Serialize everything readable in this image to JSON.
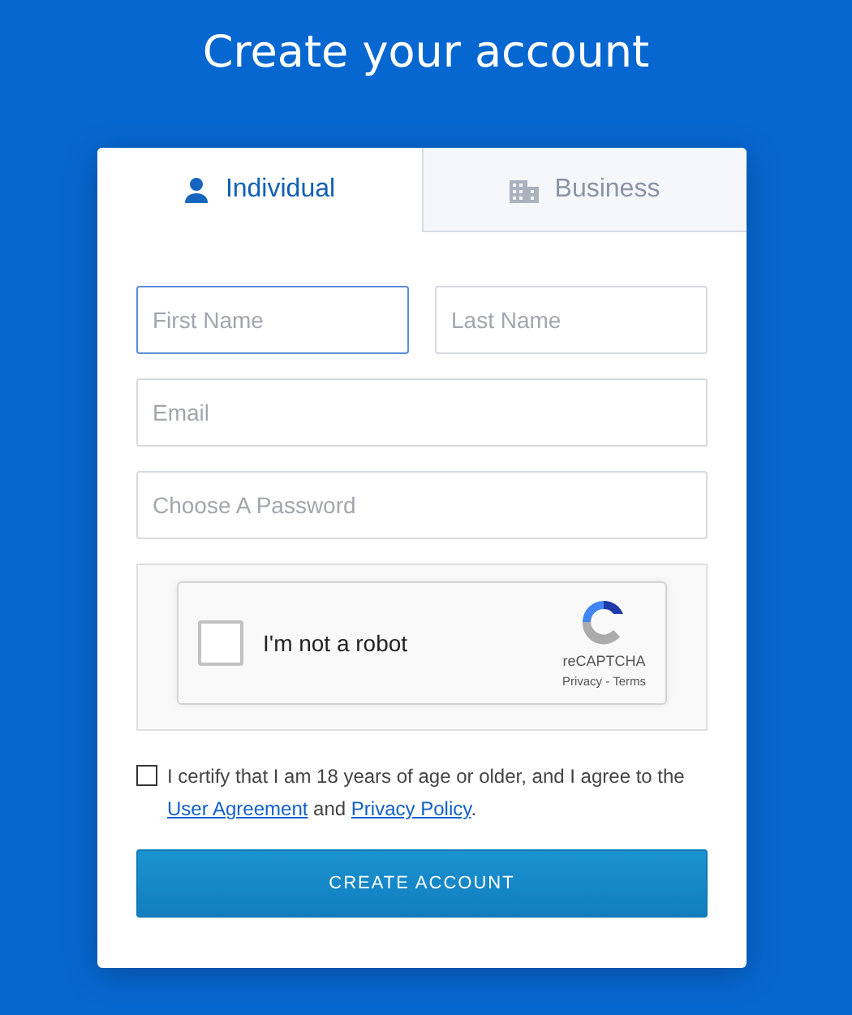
{
  "heading": "Create your account",
  "tabs": [
    {
      "label": "Individual",
      "kind": "person",
      "selected": true
    },
    {
      "label": "Business",
      "kind": "building",
      "selected": false
    }
  ],
  "name_fields": [
    {
      "placeholder": "First Name",
      "focused": true
    },
    {
      "placeholder": "Last Name",
      "focused": false
    }
  ],
  "fields": [
    {
      "placeholder": "Email",
      "focused": false
    },
    {
      "placeholder": "Choose A Password",
      "focused": false
    }
  ],
  "captcha": {
    "label": "I'm not a robot",
    "checked": false,
    "brand": "reCAPTCHA",
    "privacy": "Privacy",
    "separator": " - ",
    "terms": "Terms"
  },
  "agreement": {
    "checked": false,
    "text_before": "I certify that I am 18 years of age or older, and I agree to the ",
    "link_1": "User Agreement",
    "text_middle": " and ",
    "link_2": "Privacy Policy",
    "text_after": "."
  },
  "submit": "CREATE ACCOUNT"
}
